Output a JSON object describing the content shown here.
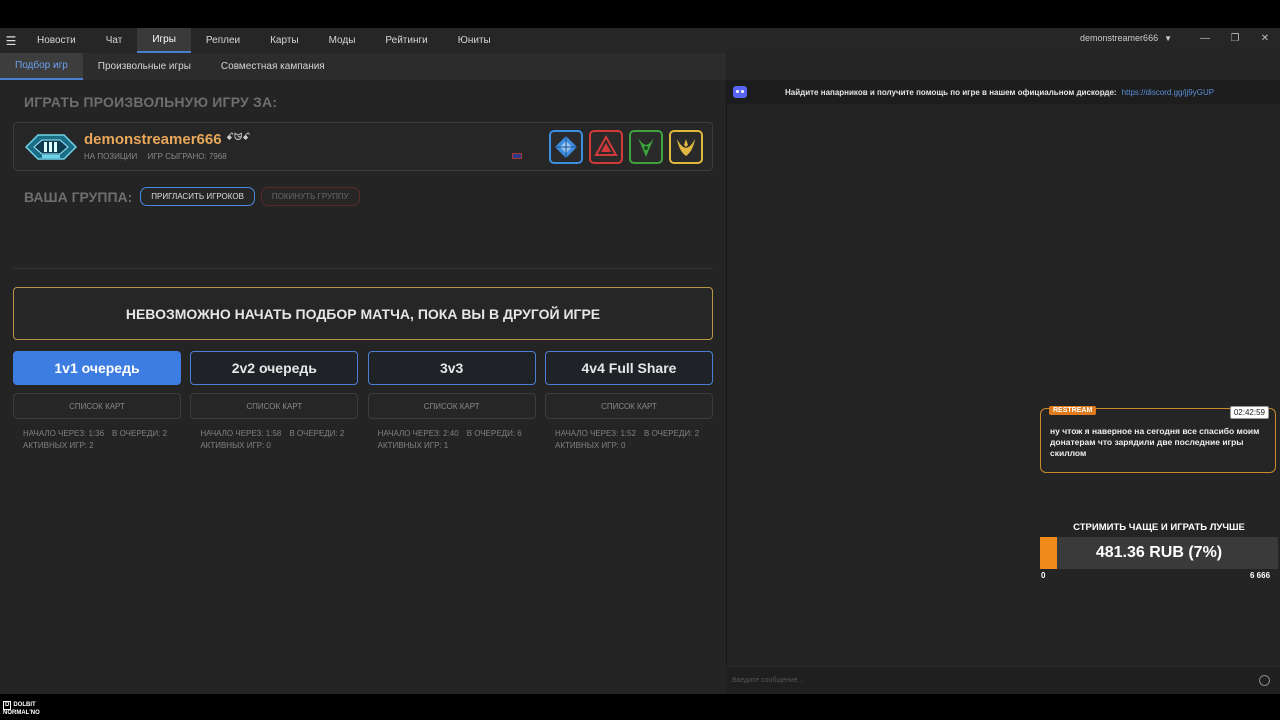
{
  "nav": {
    "items": [
      "Новости",
      "Чат",
      "Игры",
      "Реплеи",
      "Карты",
      "Моды",
      "Рейтинги",
      "Юниты"
    ],
    "active_index": 2
  },
  "user": {
    "name": "demonstreamer666"
  },
  "subnav": {
    "items": [
      "Подбор игр",
      "Произвольные игры",
      "Совместная кампания"
    ],
    "active_index": 0
  },
  "play_custom": {
    "title": "ИГРАТЬ ПРОИЗВОЛЬНУЮ ИГРУ ЗА:"
  },
  "player": {
    "name": "demonstreamer666",
    "tag": "ꗃᗢ̴ꗃ",
    "position_label": "НА ПОЗИЦИИ",
    "games_played": "ИГР СЫГРАНО: 7968"
  },
  "races": [
    "random",
    "terran",
    "zerg",
    "protoss"
  ],
  "group": {
    "label": "ВАША ГРУППА:",
    "invite_label": "ПРИГЛАСИТЬ ИГРОКОВ",
    "leave_label": "ПОКИНУТЬ ГРУППУ"
  },
  "warning": "НЕВОЗМОЖНО НАЧАТЬ ПОДБОР МАТЧА, ПОКА ВЫ В ДРУГОЙ ИГРЕ",
  "queues": [
    {
      "label": "1v1 очередь",
      "maplist": "СПИСОК КАРТ",
      "start": "НАЧАЛО ЧЕРЕЗ: 1:36",
      "in_queue": "В ОЧЕРЕДИ: 2",
      "active": "АКТИВНЫХ ИГР: 2"
    },
    {
      "label": "2v2 очередь",
      "maplist": "СПИСОК КАРТ",
      "start": "НАЧАЛО ЧЕРЕЗ: 1:58",
      "in_queue": "В ОЧЕРЕДИ: 2",
      "active": "АКТИВНЫХ ИГР: 0"
    },
    {
      "label": "3v3",
      "maplist": "СПИСОК КАРТ",
      "start": "НАЧАЛО ЧЕРЕЗ: 2:40",
      "in_queue": "В ОЧЕРЕДИ: 6",
      "active": "АКТИВНЫХ ИГР: 1"
    },
    {
      "label": "4v4 Full Share",
      "maplist": "СПИСОК КАРТ",
      "start": "НАЧАЛО ЧЕРЕЗ: 1:52",
      "in_queue": "В ОЧЕРЕДИ: 2",
      "active": "АКТИВНЫХ ИГР: 0"
    }
  ],
  "discord": {
    "text": "Найдите напарников и получите помощь по игре в нашем официальном дискорде:",
    "link": "https://discord.gg/jj9yGUP"
  },
  "chat": {
    "placeholder": "Введите сообщение..."
  },
  "restream": {
    "tag": "RESTREAM",
    "time": "02:42:59",
    "message": "ну чтож я наверное на сегодня все спасибо моим донатерам что зарядили две последние игры скиллом"
  },
  "goal": {
    "title": "СТРИМИТЬ ЧАЩЕ И ИГРАТЬ ЛУЧШЕ",
    "value": "481.36 RUB (7%)",
    "progress_percent": 7,
    "min": "0",
    "max": "6 666"
  },
  "watermark": {
    "line1": "DOLBIT",
    "line2": "NORMAL'NO"
  },
  "colors": {
    "accent": "#4a7fd4",
    "player_name": "#e8a75a",
    "goal": "#f08b1a",
    "warning_border": "#b89548"
  }
}
